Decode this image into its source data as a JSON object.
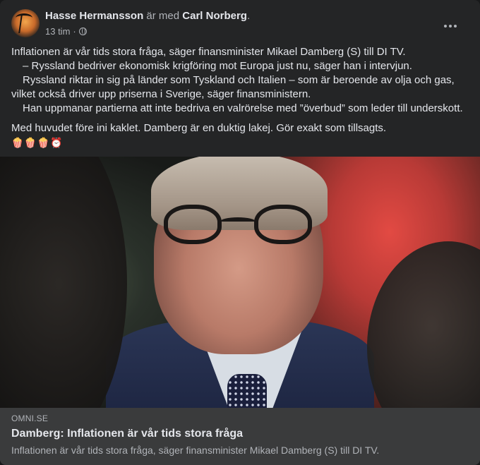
{
  "post": {
    "author": "Hasse Hermansson",
    "with_text": "är med",
    "tagged": "Carl Norberg",
    "tagged_suffix": ".",
    "time": "13 tim",
    "time_sep": "·",
    "privacy_icon": "globe-icon",
    "more_icon": "more-options-icon",
    "body": [
      "Inflationen är vår tids stora fråga, säger finansminister Mikael Damberg (S) till DI TV.",
      "– Ryssland bedriver ekonomisk krigföring mot Europa just nu, säger han i intervjun.",
      "Ryssland riktar in sig på länder som  Tyskland och Italien – som är beroende av olja och gas, vilket också driver upp priserna i Sverige, säger finansministern.",
      "Han uppmanar partierna att inte bedriva en valrörelse med ”överbud” som leder till underskott."
    ],
    "comment": "Med huvudet före ini kaklet. Damberg är en duktig lakej. Gör exakt som tillsagts.",
    "emojis": "🍿🍿🍿⏰"
  },
  "link_preview": {
    "domain": "OMNI.SE",
    "title": "Damberg: Inflationen är vår tids stora fråga",
    "description": "Inflationen är vår tids stora fråga, säger finansminister Mikael Damberg (S) till DI TV."
  },
  "colors": {
    "card_bg": "#242526",
    "link_bg": "#3a3b3c",
    "text_primary": "#e4e6eb",
    "text_secondary": "#b0b3b8"
  }
}
